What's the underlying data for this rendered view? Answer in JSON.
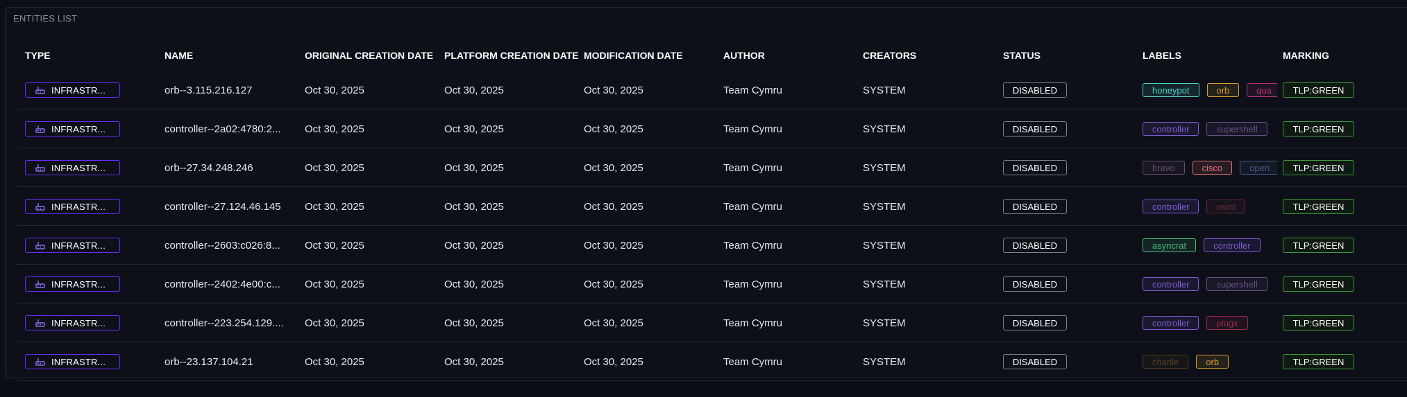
{
  "panel": {
    "title": "ENTITIES LIST"
  },
  "columns": {
    "type": "TYPE",
    "name": "NAME",
    "original_creation_date": "ORIGINAL CREATION DATE",
    "platform_creation_date": "PLATFORM CREATION DATE",
    "modification_date": "MODIFICATION DATE",
    "author": "AUTHOR",
    "creators": "CREATORS",
    "status": "STATUS",
    "labels": "LABELS",
    "marking": "MARKING"
  },
  "type_icon": "infrastructure-icon",
  "rows": [
    {
      "type": "INFRASTR...",
      "name": "orb--3.115.216.127",
      "original": "Oct 30, 2025",
      "platform": "Oct 30, 2025",
      "modified": "Oct 30, 2025",
      "author": "Team Cymru",
      "creators": "SYSTEM",
      "status": "DISABLED",
      "labels": [
        {
          "text": "honeypot",
          "color": "#4fd1c5"
        },
        {
          "text": "orb",
          "color": "#d69e2e"
        },
        {
          "text": "qua",
          "color": "#b83280"
        }
      ],
      "marking": "TLP:GREEN"
    },
    {
      "type": "INFRASTR...",
      "name": "controller--2a02:4780:2...",
      "original": "Oct 30, 2025",
      "platform": "Oct 30, 2025",
      "modified": "Oct 30, 2025",
      "author": "Team Cymru",
      "creators": "SYSTEM",
      "status": "DISABLED",
      "labels": [
        {
          "text": "controller",
          "color": "#805ad5"
        },
        {
          "text": "supershell",
          "color": "#6b4f8a"
        }
      ],
      "marking": "TLP:GREEN"
    },
    {
      "type": "INFRASTR...",
      "name": "orb--27.34.248.246",
      "original": "Oct 30, 2025",
      "platform": "Oct 30, 2025",
      "modified": "Oct 30, 2025",
      "author": "Team Cymru",
      "creators": "SYSTEM",
      "status": "DISABLED",
      "labels": [
        {
          "text": "bravo",
          "color": "#6e4a6e"
        },
        {
          "text": "cisco",
          "color": "#e57373"
        },
        {
          "text": "open",
          "color": "#4a5a8a"
        }
      ],
      "marking": "TLP:GREEN"
    },
    {
      "type": "INFRASTR...",
      "name": "controller--27.124.46.145",
      "original": "Oct 30, 2025",
      "platform": "Oct 30, 2025",
      "modified": "Oct 30, 2025",
      "author": "Team Cymru",
      "creators": "SYSTEM",
      "status": "DISABLED",
      "labels": [
        {
          "text": "controller",
          "color": "#805ad5"
        },
        {
          "text": "osint",
          "color": "#6b2a3a"
        }
      ],
      "marking": "TLP:GREEN"
    },
    {
      "type": "INFRASTR...",
      "name": "controller--2603:c026:8...",
      "original": "Oct 30, 2025",
      "platform": "Oct 30, 2025",
      "modified": "Oct 30, 2025",
      "author": "Team Cymru",
      "creators": "SYSTEM",
      "status": "DISABLED",
      "labels": [
        {
          "text": "asyncrat",
          "color": "#48bb78"
        },
        {
          "text": "controller",
          "color": "#805ad5"
        }
      ],
      "marking": "TLP:GREEN"
    },
    {
      "type": "INFRASTR...",
      "name": "controller--2402:4e00:c...",
      "original": "Oct 30, 2025",
      "platform": "Oct 30, 2025",
      "modified": "Oct 30, 2025",
      "author": "Team Cymru",
      "creators": "SYSTEM",
      "status": "DISABLED",
      "labels": [
        {
          "text": "controller",
          "color": "#805ad5"
        },
        {
          "text": "supershell",
          "color": "#6b4f8a"
        }
      ],
      "marking": "TLP:GREEN"
    },
    {
      "type": "INFRASTR...",
      "name": "controller--223.254.129....",
      "original": "Oct 30, 2025",
      "platform": "Oct 30, 2025",
      "modified": "Oct 30, 2025",
      "author": "Team Cymru",
      "creators": "SYSTEM",
      "status": "DISABLED",
      "labels": [
        {
          "text": "controller",
          "color": "#805ad5"
        },
        {
          "text": "plugx",
          "color": "#9b2c4a"
        }
      ],
      "marking": "TLP:GREEN"
    },
    {
      "type": "INFRASTR...",
      "name": "orb--23.137.104.21",
      "original": "Oct 30, 2025",
      "platform": "Oct 30, 2025",
      "modified": "Oct 30, 2025",
      "author": "Team Cymru",
      "creators": "SYSTEM",
      "status": "DISABLED",
      "labels": [
        {
          "text": "charlie",
          "color": "#5a4020"
        },
        {
          "text": "orb",
          "color": "#d69e2e"
        }
      ],
      "marking": "TLP:GREEN"
    }
  ],
  "colors": {
    "background": "#0b0e16",
    "type_chip_border": "#6c2bff",
    "marking_border": "#3f9a3f",
    "status_border": "#7b808c"
  }
}
